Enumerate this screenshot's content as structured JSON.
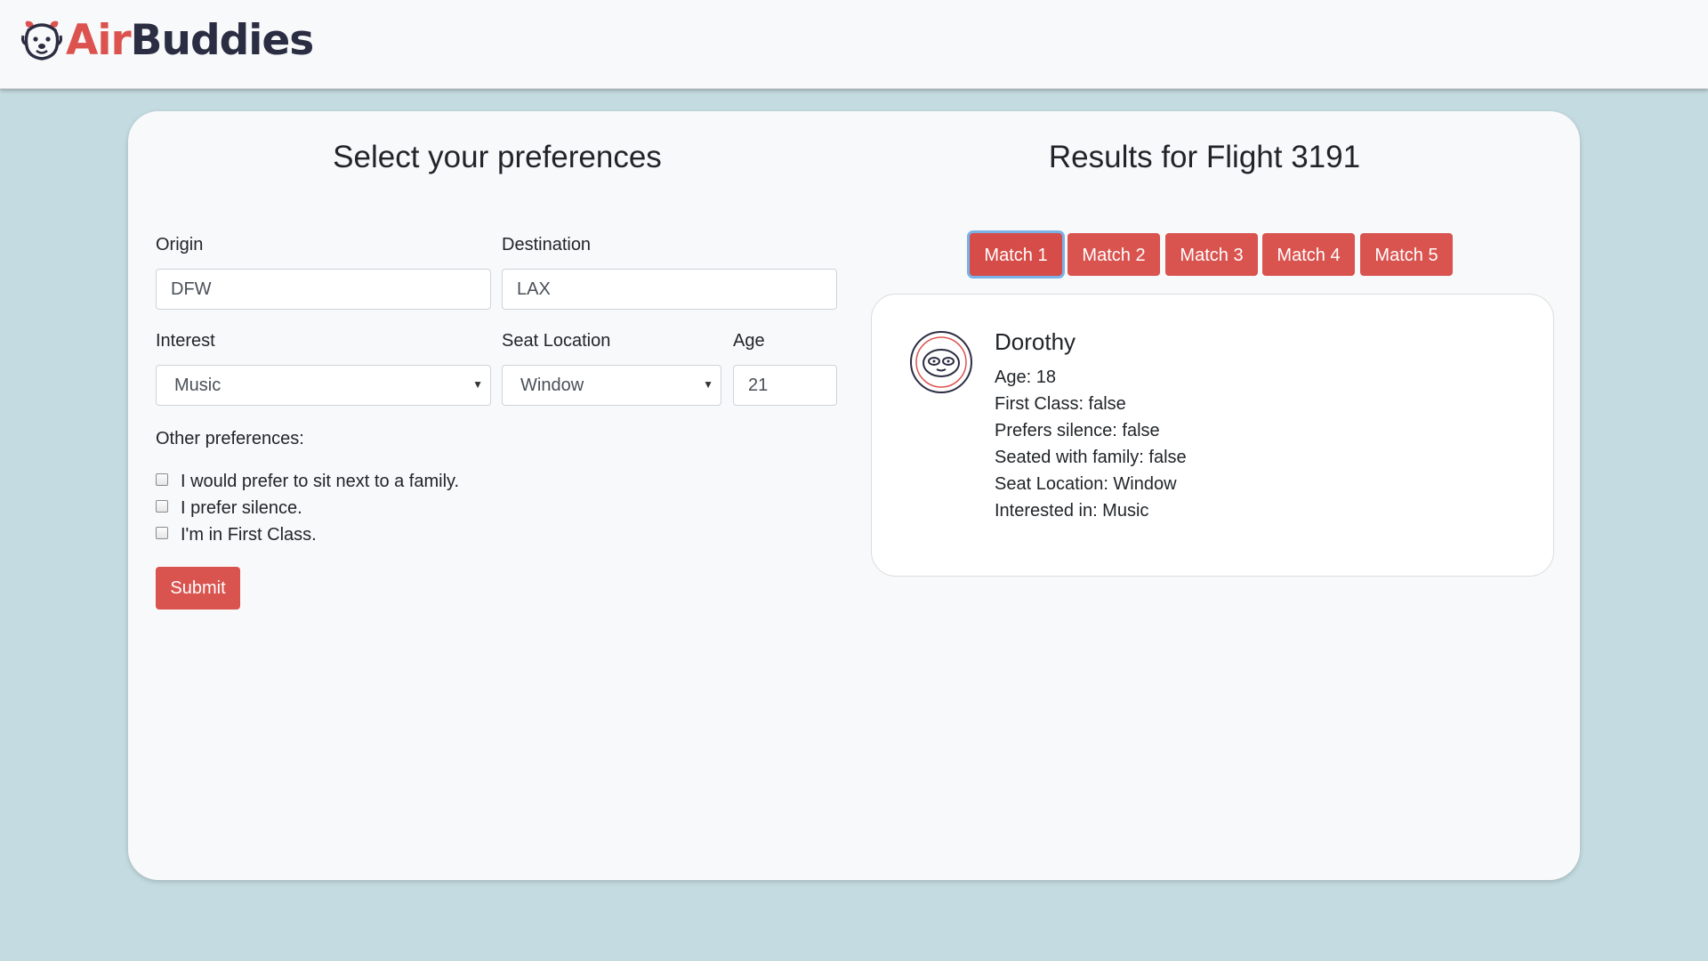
{
  "brand": {
    "part1": "Air",
    "part2": "Buddies",
    "color_primary": "#dc524f",
    "color_dark": "#2b2d42",
    "icon": "dog-face-icon"
  },
  "preferences": {
    "title": "Select your preferences",
    "origin_label": "Origin",
    "origin_value": "DFW",
    "destination_label": "Destination",
    "destination_value": "LAX",
    "interest_label": "Interest",
    "interest_value": "Music",
    "seat_label": "Seat Location",
    "seat_value": "Window",
    "age_label": "Age",
    "age_value": "21",
    "other_label": "Other preferences:",
    "checks": [
      {
        "label": "I would prefer to sit next to a family.",
        "checked": false
      },
      {
        "label": "I prefer silence.",
        "checked": false
      },
      {
        "label": "I'm in First Class.",
        "checked": false
      }
    ],
    "submit_label": "Submit"
  },
  "results": {
    "title": "Results for Flight 3191",
    "matches": [
      "Match 1",
      "Match 2",
      "Match 3",
      "Match 4",
      "Match 5"
    ],
    "active_match": "Match 1",
    "person": {
      "avatar_icon": "sloth-face-icon",
      "name": "Dorothy",
      "details": [
        "Age: 18",
        "First Class: false",
        "Prefers silence: false",
        "Seated with family: false",
        "Seat Location: Window",
        "Interested in: Music"
      ]
    }
  },
  "colors": {
    "accent": "#d9534f",
    "page_bg": "#c4dce1",
    "card_bg": "#f8f9fa",
    "focus_ring": "#7ab1e6"
  }
}
